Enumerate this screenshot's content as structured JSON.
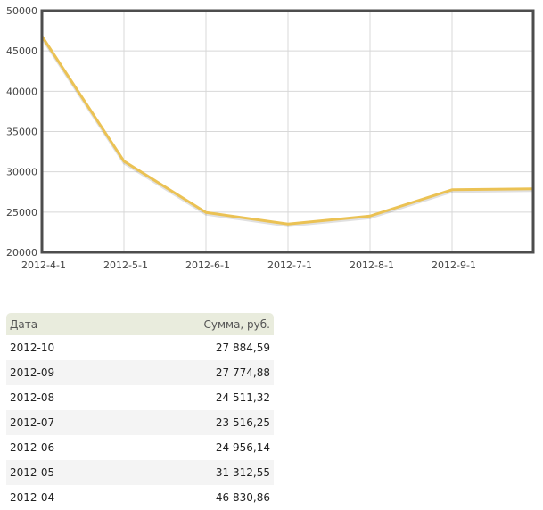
{
  "chart_data": {
    "type": "line",
    "title": "",
    "xlabel": "",
    "ylabel": "",
    "x": [
      "2012-4-1",
      "2012-5-1",
      "2012-6-1",
      "2012-7-1",
      "2012-8-1",
      "2012-9-1",
      "2012-10-1"
    ],
    "x_tick_labels": [
      "2012-4-1",
      "2012-5-1",
      "2012-6-1",
      "2012-7-1",
      "2012-8-1",
      "2012-9-1"
    ],
    "y_tick_labels": [
      "20000",
      "25000",
      "30000",
      "35000",
      "40000",
      "45000",
      "50000"
    ],
    "ylim": [
      20000,
      50000
    ],
    "grid": true,
    "series": [
      {
        "name": "Сумма",
        "color": "#ebc254",
        "values": [
          46830.86,
          31312.55,
          24956.14,
          23516.25,
          24511.32,
          27774.88,
          27884.59
        ]
      }
    ]
  },
  "table": {
    "headers": {
      "date": "Дата",
      "sum": "Сумма, руб."
    },
    "rows": [
      {
        "date": "2012-10",
        "sum": "27 884,59"
      },
      {
        "date": "2012-09",
        "sum": "27 774,88"
      },
      {
        "date": "2012-08",
        "sum": "24 511,32"
      },
      {
        "date": "2012-07",
        "sum": "23 516,25"
      },
      {
        "date": "2012-06",
        "sum": "24 956,14"
      },
      {
        "date": "2012-05",
        "sum": "31 312,55"
      },
      {
        "date": "2012-04",
        "sum": "46 830,86"
      }
    ]
  }
}
